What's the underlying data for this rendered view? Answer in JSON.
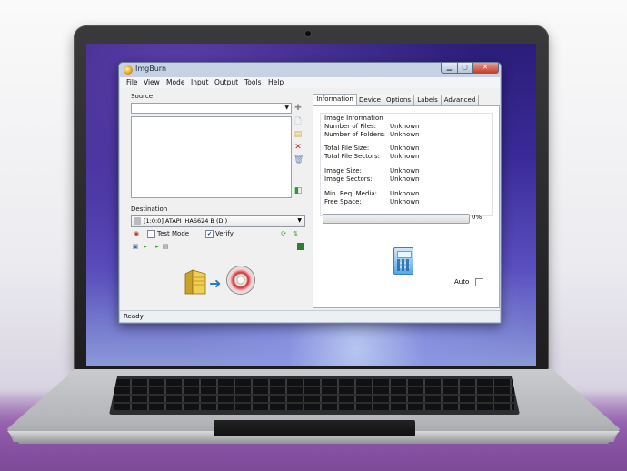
{
  "window": {
    "title": "ImgBurn",
    "controls": {
      "minimize": "▁",
      "maximize": "▢",
      "close": "✕"
    }
  },
  "menu": [
    "File",
    "View",
    "Mode",
    "Input",
    "Output",
    "Tools",
    "Help"
  ],
  "source": {
    "label": "Source",
    "value": "",
    "side_icons": [
      "add-file-icon",
      "browse-file-icon",
      "browse-folder-icon",
      "remove-icon",
      "clear-list-icon",
      "calculate-icon"
    ]
  },
  "destination": {
    "label": "Destination",
    "drive": "[1:0:0] ATAPI iHAS624   B (D:)",
    "test_mode": {
      "label": "Test Mode",
      "checked": false
    },
    "verify": {
      "label": "Verify",
      "checked": true
    }
  },
  "tabs": [
    {
      "label": "Information",
      "active": true
    },
    {
      "label": "Device",
      "active": false
    },
    {
      "label": "Options",
      "active": false
    },
    {
      "label": "Labels",
      "active": false
    },
    {
      "label": "Advanced",
      "active": false
    }
  ],
  "information": {
    "heading": "Image Information",
    "rows": [
      {
        "key": "Number of Files:",
        "value": "Unknown"
      },
      {
        "key": "Number of Folders:",
        "value": "Unknown"
      },
      {
        "key": "Total File Size:",
        "value": "Unknown"
      },
      {
        "key": "Total File Sectors:",
        "value": "Unknown"
      },
      {
        "key": "Image Size:",
        "value": "Unknown"
      },
      {
        "key": "Image Sectors:",
        "value": "Unknown"
      },
      {
        "key": "Min. Req. Media:",
        "value": "Unknown"
      },
      {
        "key": "Free Space:",
        "value": "Unknown"
      }
    ],
    "progress_percent": 0,
    "progress_label": "0%",
    "auto_label": "Auto",
    "auto_checked": false
  },
  "status": "Ready",
  "colors": {
    "progress": "#37c23f",
    "desktop": "#3a2a98"
  }
}
